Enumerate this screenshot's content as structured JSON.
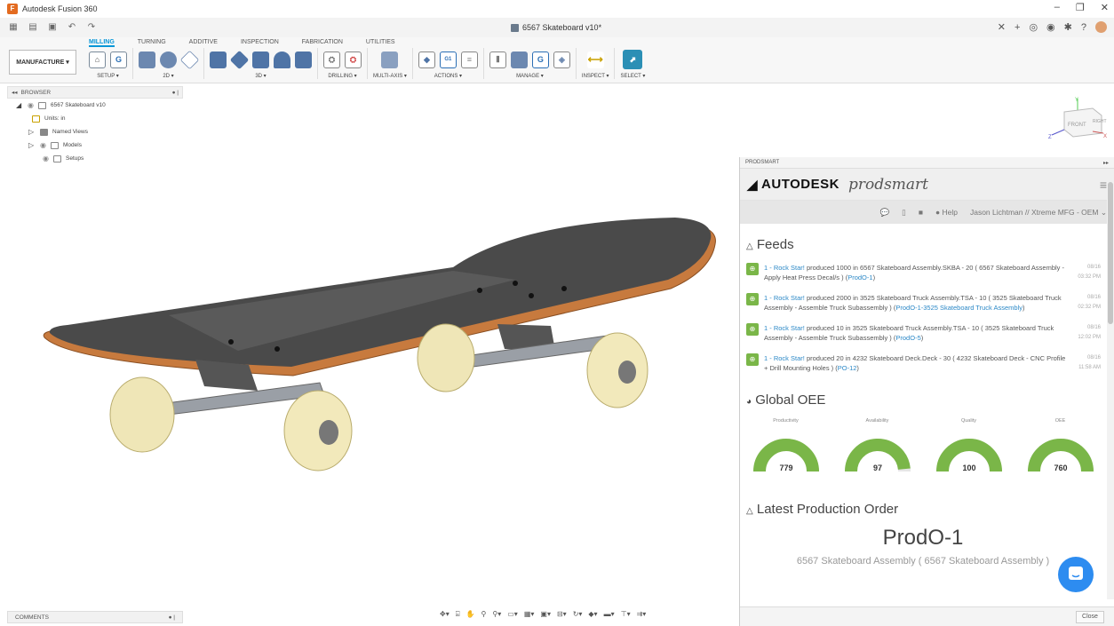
{
  "window": {
    "title": "Autodesk Fusion 360",
    "doc_title": "6567 Skateboard v10*"
  },
  "ribbon": {
    "workspace": "MANUFACTURE ▾",
    "tabs": [
      "MILLING",
      "TURNING",
      "ADDITIVE",
      "INSPECTION",
      "FABRICATION",
      "UTILITIES"
    ],
    "active_tab": "MILLING",
    "groups": [
      {
        "label": "SETUP ▾",
        "icons": [
          "setup-icon",
          "g-code-icon"
        ]
      },
      {
        "label": "2D ▾",
        "icons": [
          "2d-adaptive-icon",
          "2d-pocket-icon",
          "face-icon"
        ]
      },
      {
        "label": "3D ▾",
        "icons": [
          "3d-adaptive-icon",
          "pocket-icon",
          "steep-shallow-icon",
          "scallop-icon",
          "contour-icon"
        ]
      },
      {
        "label": "DRILLING ▾",
        "icons": [
          "drill-icon",
          "hole-recognition-icon"
        ]
      },
      {
        "label": "MULTI-AXIS ▾",
        "icons": [
          "swarf-icon"
        ]
      },
      {
        "label": "ACTIONS ▾",
        "icons": [
          "simulate-icon",
          "post-process-icon",
          "setup-sheet-icon"
        ]
      },
      {
        "label": "MANAGE ▾",
        "icons": [
          "tool-library-icon",
          "machine-library-icon",
          "post-library-icon",
          "template-icon"
        ]
      },
      {
        "label": "INSPECT ▾",
        "icons": [
          "measure-icon"
        ]
      },
      {
        "label": "SELECT ▾",
        "icons": [
          "select-icon"
        ]
      }
    ]
  },
  "browser": {
    "title": "BROWSER",
    "items": [
      {
        "label": "6567 Skateboard v10",
        "depth": 0
      },
      {
        "label": "Units: in",
        "depth": 1
      },
      {
        "label": "Named Views",
        "depth": 1
      },
      {
        "label": "Models",
        "depth": 1
      },
      {
        "label": "Setups",
        "depth": 1
      }
    ]
  },
  "comments": {
    "label": "COMMENTS"
  },
  "viewcube": {
    "front": "FRONT",
    "right": "RIGHT",
    "x": "X",
    "y": "Y",
    "z": "Z"
  },
  "panel": {
    "title": "PRODSMART",
    "brand": "AUTODESK",
    "product": "prodsmart",
    "help": "Help",
    "user": "Jason Lichtman // Xtreme MFG - OEM",
    "feeds_title": "Feeds",
    "feeds": [
      {
        "user": "1 - Rock Star!",
        "text": " produced 1000 in 6567 Skateboard Assembly.SKBA - 20 ( 6567 Skateboard Assembly - Apply Heat Press Decal/s ) (",
        "link": "ProdO-1",
        "tail": ")",
        "date": "08/16",
        "time": "03:32 PM"
      },
      {
        "user": "1 - Rock Star!",
        "text": " produced 2000 in 3525 Skateboard Truck Assembly.TSA - 10 ( 3525 Skateboard Truck Assembly - Assemble Truck Subassembly ) (",
        "link": "ProdO-1-3525 Skateboard Truck Assembly",
        "tail": ")",
        "date": "08/16",
        "time": "02:32 PM"
      },
      {
        "user": "1 - Rock Star!",
        "text": " produced 10 in 3525 Skateboard Truck Assembly.TSA - 10 ( 3525 Skateboard Truck Assembly - Assemble Truck Subassembly ) (",
        "link": "ProdO-5",
        "tail": ")",
        "date": "08/16",
        "time": "12:02 PM"
      },
      {
        "user": "1 - Rock Star!",
        "text": " produced 20 in 4232 Skateboard Deck.Deck - 30 ( 4232 Skateboard Deck - CNC Profile + Drill Mounting Holes ) (",
        "link": "PO-12",
        "tail": ")",
        "date": "08/16",
        "time": "11:58 AM"
      }
    ],
    "oee_title": "Global OEE",
    "gauges": [
      {
        "label": "Productivity",
        "value": "779",
        "fraction": 1.0
      },
      {
        "label": "Availability",
        "value": "97",
        "fraction": 0.97
      },
      {
        "label": "Quality",
        "value": "100",
        "fraction": 1.0
      },
      {
        "label": "OEE",
        "value": "760",
        "fraction": 1.0
      }
    ],
    "gauge_color": "#7ab648",
    "latest_title": "Latest Production Order",
    "latest_order": "ProdO-1",
    "latest_desc": "6567 Skateboard Assembly ( 6567 Skateboard Assembly )",
    "close": "Close"
  }
}
